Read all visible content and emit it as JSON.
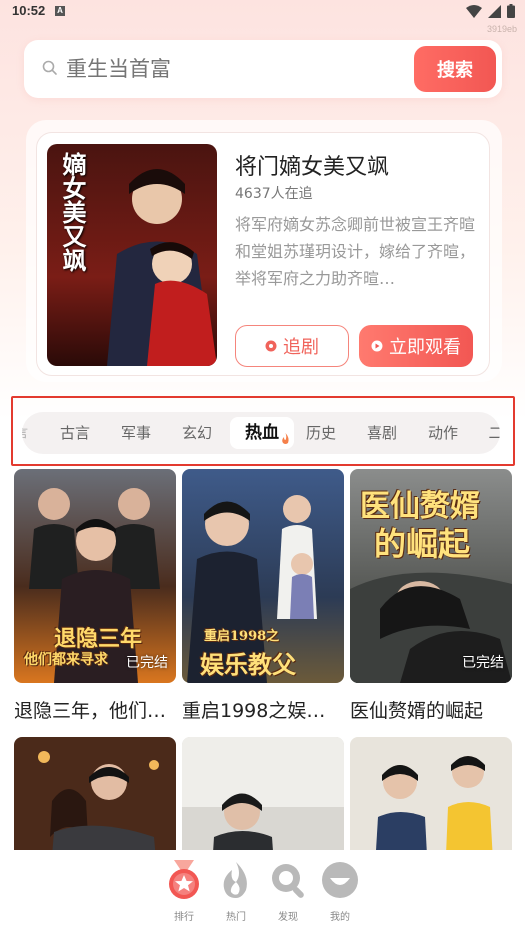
{
  "status_bar": {
    "time": "10:52",
    "app_icon": "A",
    "build_tag": "3919eb"
  },
  "search": {
    "placeholder": "重生当首富",
    "button_label": "搜索"
  },
  "featured": {
    "title": "将门嫡女美又飒",
    "followers": "4637人在追",
    "description": "将军府嫡女苏念卿前世被宣王齐暄和堂姐苏瑾玥设计，嫁给了齐暄，举将军府之力助齐暄…",
    "follow_label": "追剧",
    "watch_label": "立即观看",
    "poster_text": "嫡女美又飒"
  },
  "categories": {
    "items": [
      "言",
      "古言",
      "军事",
      "玄幻",
      "热血",
      "历史",
      "喜剧",
      "动作",
      "二"
    ],
    "active": "热血"
  },
  "dramas": [
    {
      "title": "退隐三年，他们…",
      "badge": "已完结",
      "poster_text": "退隐三年",
      "poster_subtext": "他们都来寻求"
    },
    {
      "title": "重启1998之娱…",
      "badge": "",
      "poster_text": "娱乐教父",
      "poster_subtext": "重启1998之"
    },
    {
      "title": "医仙赘婿的崛起",
      "badge": "已完结",
      "poster_text": "医仙赘婿",
      "poster_subtext": "的崛起"
    }
  ],
  "bottom_nav": [
    {
      "label": "排行",
      "icon": "ranking-medal-icon",
      "active": true
    },
    {
      "label": "热门",
      "icon": "flame-icon",
      "active": false
    },
    {
      "label": "发现",
      "icon": "discover-search-icon",
      "active": false
    },
    {
      "label": "我的",
      "icon": "profile-face-icon",
      "active": false
    }
  ],
  "colors": {
    "accent": "#f25753",
    "highlight_frame": "#e33a2f"
  }
}
